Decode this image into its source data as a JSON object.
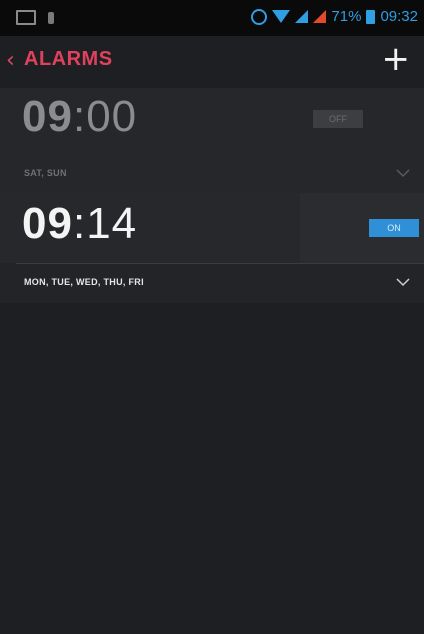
{
  "status_bar": {
    "battery_percent": "71%",
    "time": "09:32",
    "icons": [
      "image-icon",
      "usb-icon",
      "alarm-icon",
      "wifi-icon",
      "signal-icon",
      "signal-icon",
      "battery-icon"
    ]
  },
  "action_bar": {
    "back_icon": "chevron-left-icon",
    "title": "ALARMS",
    "add_icon": "plus-icon"
  },
  "alarms": [
    {
      "hour": "09",
      "separator": ":",
      "minute": "00",
      "toggle_label": "OFF",
      "enabled": false,
      "days": "SAT, SUN",
      "expand_icon": "chevron-down-icon"
    },
    {
      "hour": "09",
      "separator": ":",
      "minute": "14",
      "toggle_label": "ON",
      "enabled": true,
      "days": "MON, TUE, WED, THU, FRI",
      "expand_icon": "chevron-down-icon"
    }
  ],
  "colors": {
    "accent_title": "#e0415d",
    "toggle_on": "#2f90d8",
    "status_blue": "#2f9ee3",
    "background": "#1e1f22"
  }
}
